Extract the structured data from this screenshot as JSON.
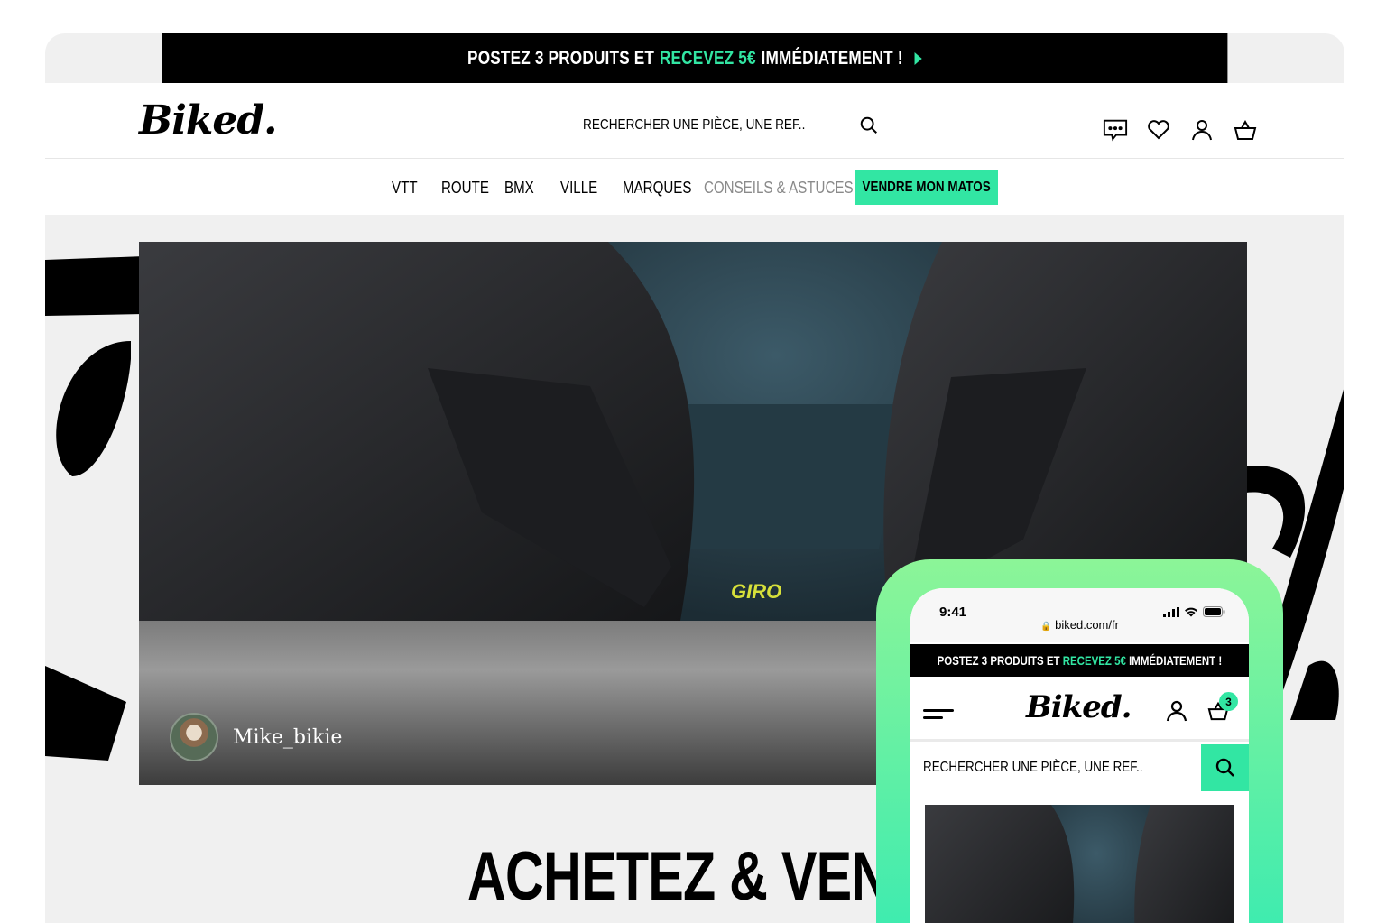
{
  "promo": {
    "part1": "POSTEZ 3 PRODUITS ET",
    "highlight": "RECEVEZ 5€",
    "part2": "IMMÉDIATEMENT !",
    "arrow_icon": "play-arrow-icon"
  },
  "header": {
    "logo": "Biked.",
    "search_placeholder": "RECHERCHER UNE PIÈCE, UNE REF..",
    "icons": [
      "chat-icon",
      "heart-icon",
      "user-icon",
      "basket-icon"
    ]
  },
  "nav": {
    "items": [
      "VTT",
      "ROUTE",
      "BMX",
      "VILLE",
      "MARQUES",
      "CONSEILS & ASTUCES"
    ],
    "cta": "VENDRE MON MATOS"
  },
  "hero": {
    "credit_name": "Mike_bikie",
    "headline": "ACHETEZ & VENDE",
    "brand_text": "GIRO"
  },
  "mobile": {
    "time": "9:41",
    "url": "biked.com/fr",
    "promo_part1": "POSTEZ 3 PRODUITS ET",
    "promo_highlight": "RECEVEZ 5€",
    "promo_part2": "IMMÉDIATEMENT !",
    "logo": "Biked.",
    "cart_count": "3",
    "search_placeholder": "RECHERCHER UNE PIÈCE, UNE REF.."
  },
  "colors": {
    "accent": "#32e6a3",
    "phone_gradient_top": "#8cf598",
    "phone_gradient_bottom": "#3cebb0",
    "background": "#f0f0f0"
  }
}
